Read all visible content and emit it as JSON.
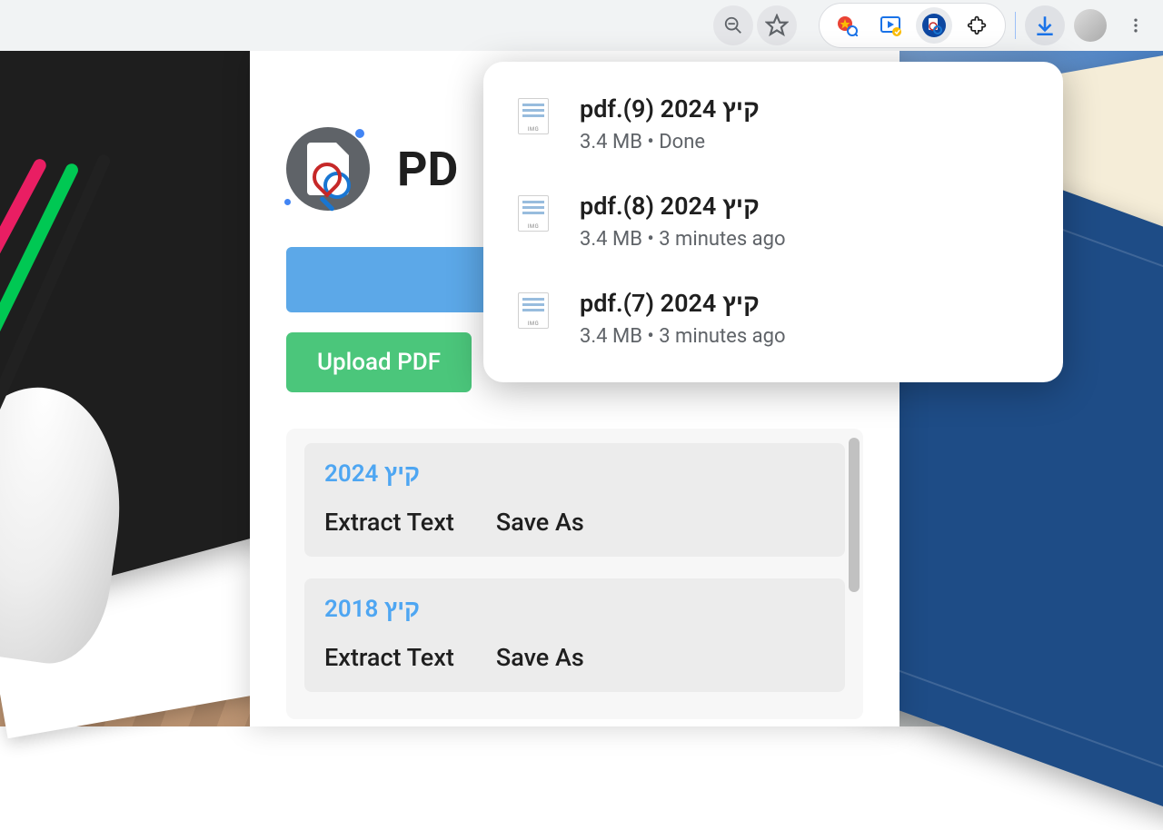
{
  "app": {
    "title_truncated": "PD",
    "upload_label": "Upload PDF"
  },
  "files": [
    {
      "title": "קיץ 2024",
      "extract": "Extract Text",
      "save": "Save As"
    },
    {
      "title": "קיץ 2018",
      "extract": "Extract Text",
      "save": "Save As"
    }
  ],
  "downloads": [
    {
      "name": "pdf.(9) 2024 קיץ",
      "meta": "3.4 MB • Done"
    },
    {
      "name": "pdf.(8) 2024 קיץ",
      "meta": "3.4 MB • 3 minutes ago"
    },
    {
      "name": "pdf.(7) 2024 קיץ",
      "meta": "3.4 MB • 3 minutes ago"
    }
  ]
}
